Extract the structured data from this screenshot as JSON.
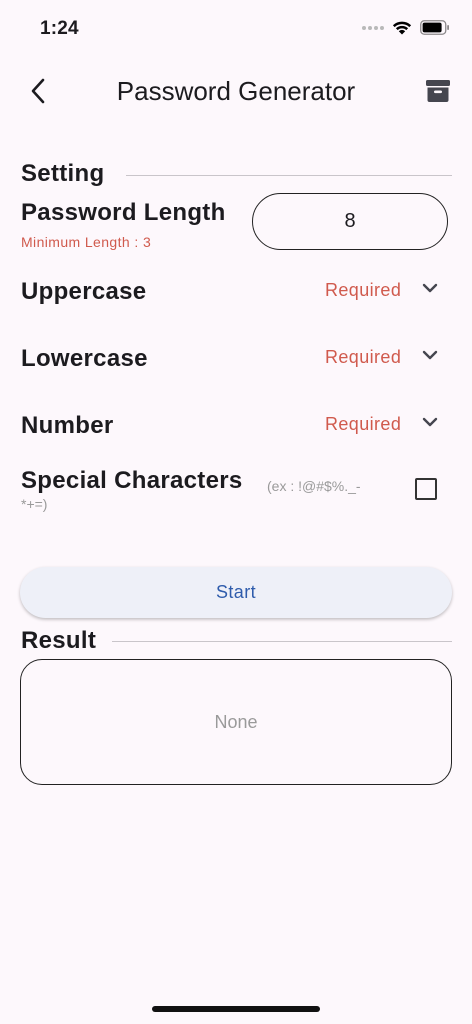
{
  "status_bar": {
    "time": "1:24"
  },
  "app_bar": {
    "title": "Password Generator"
  },
  "setting": {
    "title": "Setting",
    "password_length": {
      "label": "Password Length",
      "hint": "Minimum Length : 3",
      "value": "8"
    },
    "uppercase": {
      "label": "Uppercase",
      "value": "Required"
    },
    "lowercase": {
      "label": "Lowercase",
      "value": "Required"
    },
    "number": {
      "label": "Number",
      "value": "Required"
    },
    "special": {
      "label": "Special Characters",
      "hint_line1": "(ex : !@#$%._-",
      "hint_line2": "*+=)",
      "checked": false
    }
  },
  "start_button": {
    "label": "Start"
  },
  "result": {
    "title": "Result",
    "value": "None"
  },
  "colors": {
    "accent_red": "#d05a4d",
    "button_text": "#2f5cac",
    "background": "#fdf8fc"
  }
}
